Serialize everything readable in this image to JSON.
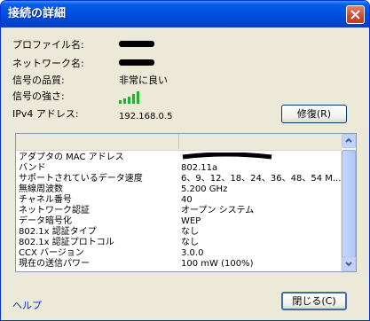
{
  "window": {
    "title": "接続の詳細"
  },
  "summary": {
    "profile_label": "プロファイル名:",
    "network_label": "ネットワーク名:",
    "quality_label": "信号の品質:",
    "quality_value": "非常に良い",
    "strength_label": "信号の強さ:",
    "signal_bars_filled": 5,
    "signal_bars_total": 5,
    "ipv4_label": "IPv4 アドレス:",
    "ipv4_value": "192.168.0.5",
    "repair_button": "修復(R)"
  },
  "details": {
    "rows": [
      {
        "key": "アダプタの MAC アドレス",
        "value": ""
      },
      {
        "key": "バンド",
        "value": "802.11a"
      },
      {
        "key": "サポートされているデータ速度",
        "value": "6、9、12、18、24、36、48、54 M..."
      },
      {
        "key": "無線周波数",
        "value": "5.200 GHz"
      },
      {
        "key": "チャネル番号",
        "value": "40"
      },
      {
        "key": "ネットワーク認証",
        "value": "オープン システム"
      },
      {
        "key": "データ暗号化",
        "value": "WEP"
      },
      {
        "key": "802.1x 認証タイプ",
        "value": "なし"
      },
      {
        "key": "802.1x 認証プロトコル",
        "value": "なし"
      },
      {
        "key": "CCX バージョン",
        "value": "3.0.0"
      },
      {
        "key": "現在の送信パワー",
        "value": "100 mW (100%)"
      }
    ]
  },
  "footer": {
    "help_link": "ヘルプ",
    "close_button": "閉じる(C)"
  },
  "colors": {
    "title_blue": "#0054e3",
    "signal_green": "#1db42c",
    "link_blue": "#0033cc"
  }
}
